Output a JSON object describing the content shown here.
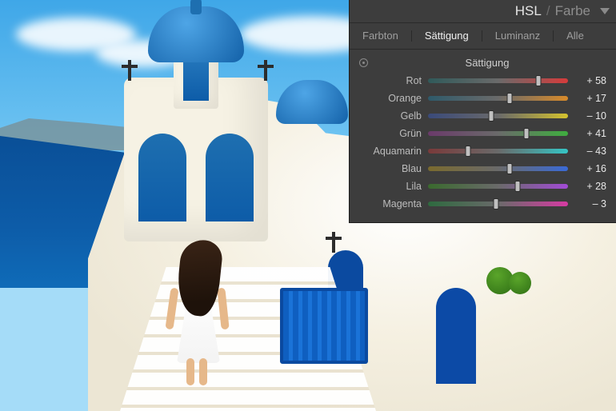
{
  "panel": {
    "title_primary": "HSL",
    "title_separator": "/",
    "title_secondary": "Farbe",
    "tabs": {
      "hue": "Farbton",
      "saturation": "Sättigung",
      "luminance": "Luminanz",
      "all": "Alle",
      "active": "saturation"
    },
    "section_title": "Sättigung",
    "sliders": [
      {
        "key": "red",
        "label": "Rot",
        "value": 58,
        "grad": "grad-red"
      },
      {
        "key": "orange",
        "label": "Orange",
        "value": 17,
        "grad": "grad-orange"
      },
      {
        "key": "yellow",
        "label": "Gelb",
        "value": -10,
        "grad": "grad-yellow"
      },
      {
        "key": "green",
        "label": "Grün",
        "value": 41,
        "grad": "grad-green"
      },
      {
        "key": "aqua",
        "label": "Aquamarin",
        "value": -43,
        "grad": "grad-aqua"
      },
      {
        "key": "blue",
        "label": "Blau",
        "value": 16,
        "grad": "grad-blue"
      },
      {
        "key": "purple",
        "label": "Lila",
        "value": 28,
        "grad": "grad-purple"
      },
      {
        "key": "magenta",
        "label": "Magenta",
        "value": -3,
        "grad": "grad-magenta"
      }
    ],
    "range": {
      "min": -100,
      "max": 100
    }
  }
}
